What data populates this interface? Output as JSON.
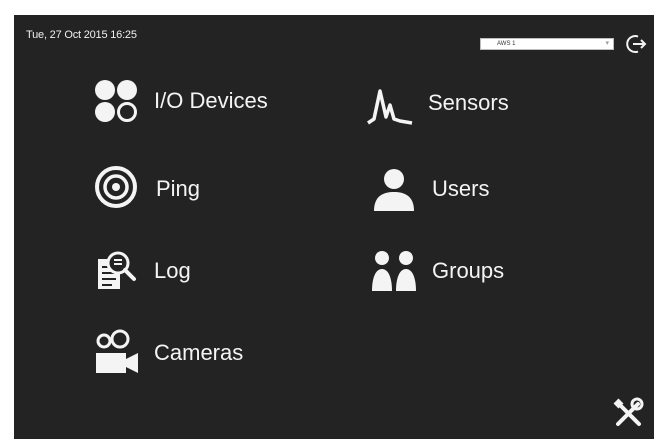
{
  "header": {
    "datetime": "Tue, 27 Oct 2015 16:25",
    "site_selector_value": "AWS 1"
  },
  "menu": {
    "io_devices": "I/O Devices",
    "sensors": "Sensors",
    "ping": "Ping",
    "users": "Users",
    "log": "Log",
    "groups": "Groups",
    "cameras": "Cameras"
  },
  "icons": [
    "logout-icon",
    "io-devices-icon",
    "sensors-icon",
    "ping-icon",
    "users-icon",
    "log-icon",
    "groups-icon",
    "cameras-icon",
    "tools-icon",
    "chevron-down-icon"
  ],
  "colors": {
    "background": "#232323",
    "foreground": "#f4f4f4"
  }
}
